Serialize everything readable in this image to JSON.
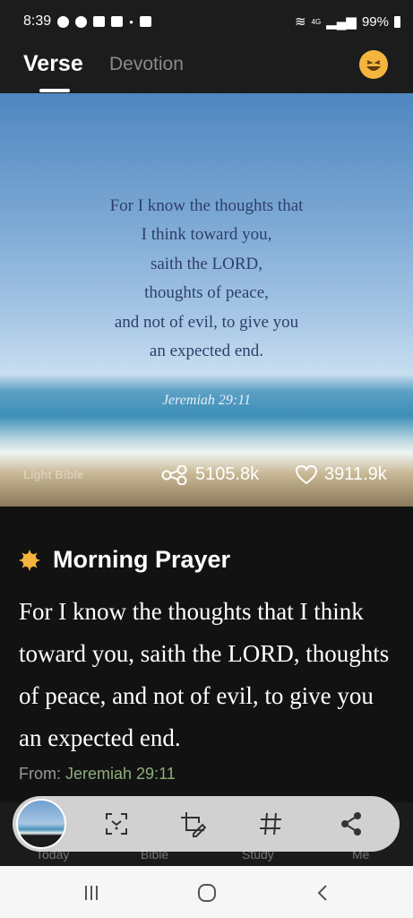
{
  "status_bar": {
    "time": "8:39",
    "network": "4G",
    "battery": "99%"
  },
  "header": {
    "tabs": [
      {
        "label": "Verse",
        "active": true
      },
      {
        "label": "Devotion",
        "active": false
      }
    ],
    "emoji_icon": "laughing-face-icon"
  },
  "verse_card": {
    "lines": [
      "For I know the thoughts that",
      "I think toward you,",
      "saith the LORD,",
      "thoughts of peace,",
      "and not of evil, to give you",
      "an expected end."
    ],
    "reference": "Jeremiah 29:11",
    "watermark": "Light Bible",
    "share_count": "5105.8k",
    "like_count": "3911.9k"
  },
  "prayer": {
    "title": "Morning Prayer",
    "text": "For I know the thoughts that I think toward you, saith the LORD, thoughts of peace, and not of evil, to give you an expected end.",
    "from_label": "From:",
    "from_ref": "Jeremiah 29:11"
  },
  "bottom_nav": {
    "labels": [
      "Today",
      "Bible",
      "Study",
      "Me"
    ]
  },
  "colors": {
    "accent_gold": "#f4b53f",
    "reference_green": "#8fae79"
  }
}
